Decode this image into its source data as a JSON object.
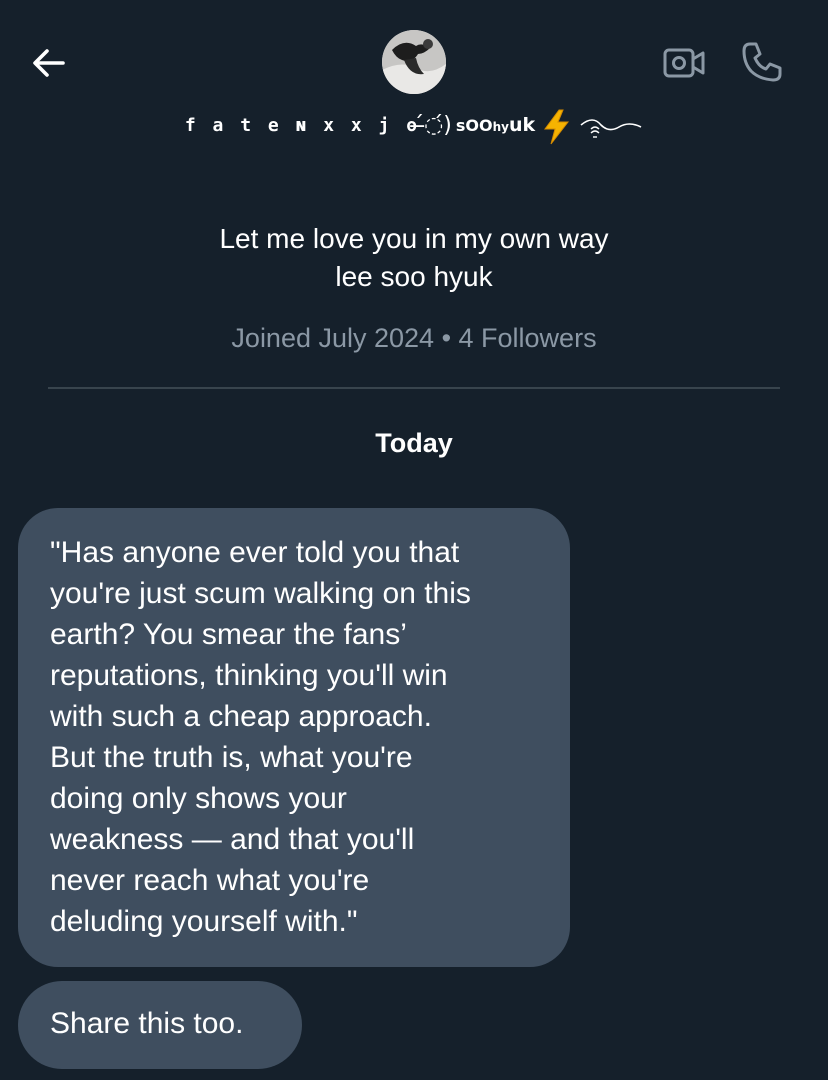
{
  "header": {
    "back_icon": "arrow-left-icon",
    "video_icon": "video-call-icon",
    "call_icon": "phone-icon",
    "display_name": {
      "part1": "f a t e ɴ x x j o",
      "deco": "̶́◌́)",
      "part2_s": "s",
      "part2_oo": "OO",
      "part2_hy": "hy",
      "part2_uk": "uk",
      "emoji": "lightning-icon",
      "wave": "wave-flourish-icon"
    }
  },
  "profile": {
    "bio_line1": "Let me love you in my own way",
    "bio_line2": "lee soo hyuk",
    "meta": "Joined July 2024 • 4 Followers"
  },
  "conversation": {
    "date_label": "Today",
    "messages": [
      {
        "lines": [
          "\"Has anyone ever told you that",
          "you're just scum walking on this",
          "earth? You smear the fans’",
          "reputations, thinking you'll win",
          "with such a cheap approach.",
          "But the truth is, what you're",
          "doing only shows your",
          "weakness — and that you'll",
          "never reach what you're",
          "deluding yourself with.\""
        ]
      },
      {
        "text": "Share this too."
      }
    ]
  },
  "colors": {
    "background": "#15202b",
    "bubble": "#3f4e5f",
    "muted_text": "#8b98a5",
    "divider": "#38444d",
    "lightning": "#f5b301"
  }
}
